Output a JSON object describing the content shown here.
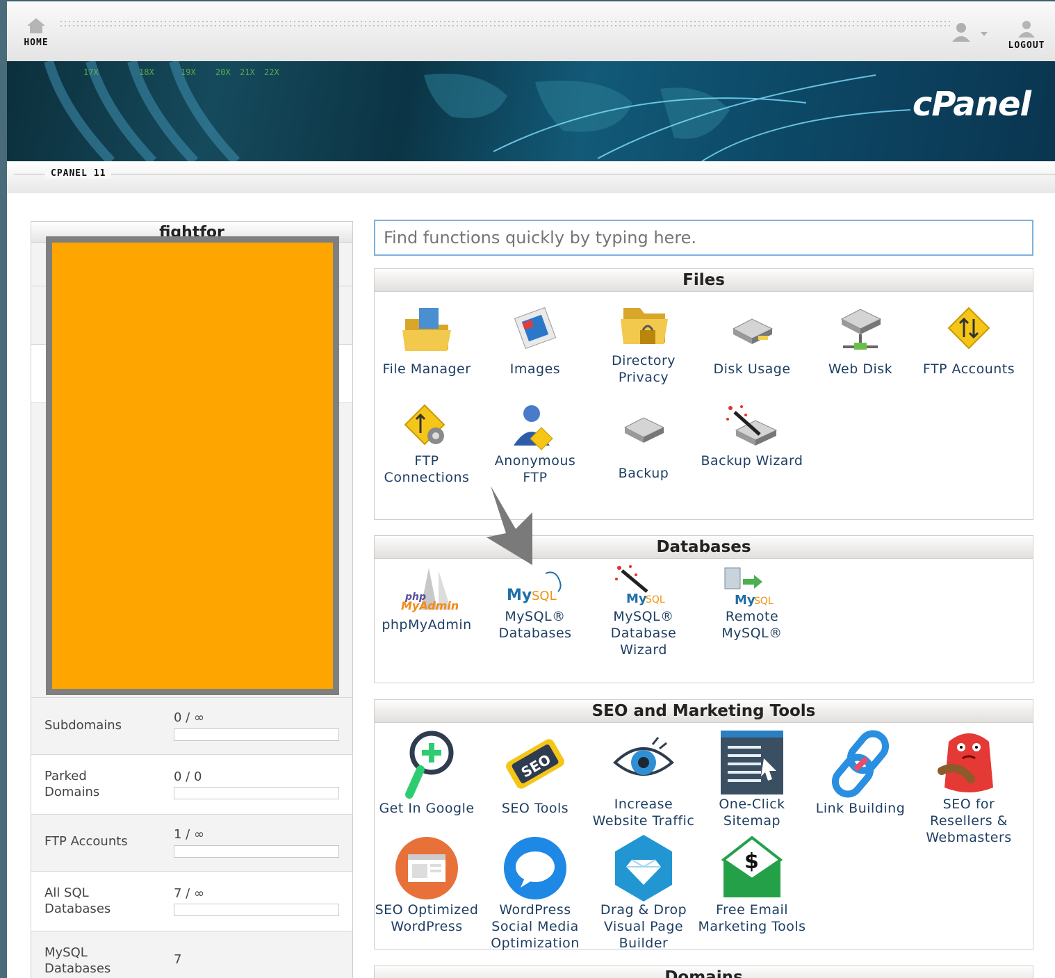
{
  "header": {
    "home_label": "HOME",
    "logout_label": "LOGOUT",
    "brand": "cPanel",
    "version": "CPANEL 11"
  },
  "search": {
    "placeholder": "Find functions quickly by typing here."
  },
  "stats": {
    "title": "fightfor",
    "rows": [
      {
        "label": "Subdomains",
        "value": "0 / ∞",
        "bar": 0
      },
      {
        "label": "Parked Domains",
        "value": "0 / 0",
        "bar": 0
      },
      {
        "label": "FTP Accounts",
        "value": "1 / ∞",
        "bar": 0
      },
      {
        "label": "All SQL Databases",
        "value": "7 / ∞",
        "bar": 0
      },
      {
        "label": "MySQL Databases",
        "value": "7"
      }
    ]
  },
  "groups": {
    "files": {
      "title": "Files",
      "items": [
        "File Manager",
        "Images",
        "Directory Privacy",
        "Disk Usage",
        "Web Disk",
        "FTP Accounts",
        "FTP Connections",
        "Anonymous FTP",
        "Backup",
        "Backup Wizard"
      ]
    },
    "databases": {
      "title": "Databases",
      "items": [
        "phpMyAdmin",
        "MySQL® Databases",
        "MySQL® Database Wizard",
        "Remote MySQL®"
      ]
    },
    "seo": {
      "title": "SEO and Marketing Tools",
      "items": [
        "Get In Google",
        "SEO Tools",
        "Increase Website Traffic",
        "One-Click Sitemap",
        "Link Building",
        "SEO for Resellers & Webmasters",
        "SEO Optimized WordPress",
        "WordPress Social Media Optimization",
        "Drag & Drop Visual Page Builder",
        "Free Email Marketing Tools"
      ]
    },
    "domains": {
      "title": "Domains"
    }
  },
  "icons": {
    "home": "home-icon",
    "user": "user-icon",
    "logout": "logout-icon",
    "files": [
      "folder-icon",
      "images-icon",
      "folder-lock-icon",
      "disk-icon",
      "web-disk-icon",
      "ftp-icon",
      "ftp-gear-icon",
      "anonymous-ftp-icon",
      "backup-icon",
      "backup-wizard-icon"
    ],
    "databases": [
      "phpmyadmin-icon",
      "mysql-icon",
      "mysql-wizard-icon",
      "remote-mysql-icon"
    ],
    "seo": [
      "magnifier-plus-icon",
      "seo-tag-icon",
      "eye-icon",
      "sitemap-icon",
      "chain-link-icon",
      "red-monster-icon",
      "wordpress-window-icon",
      "speech-bubble-icon",
      "diamond-hexagon-icon",
      "dollar-envelope-icon"
    ]
  },
  "colors": {
    "accent": "#1e3f63",
    "redaction": "#ffa500",
    "search_border": "#7fb1dc"
  }
}
